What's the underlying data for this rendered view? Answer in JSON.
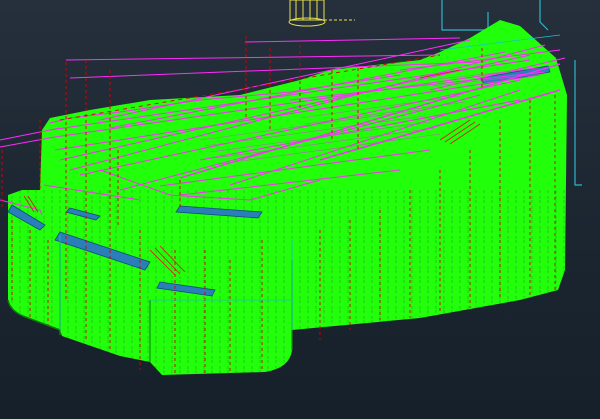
{
  "viewport": {
    "background_top": "#26303c",
    "background_bottom": "#16202a"
  },
  "model": {
    "surface_color": "#22ff0a",
    "toolpath_color": "#ff2bff",
    "rapid_move_color": "#d40000",
    "stock_outline_color": "#2bb6c8",
    "tool_holder_color": "#e6e04a",
    "pocket_color": "#2a7fb8",
    "tool_icon": "cutter-tool-icon"
  }
}
